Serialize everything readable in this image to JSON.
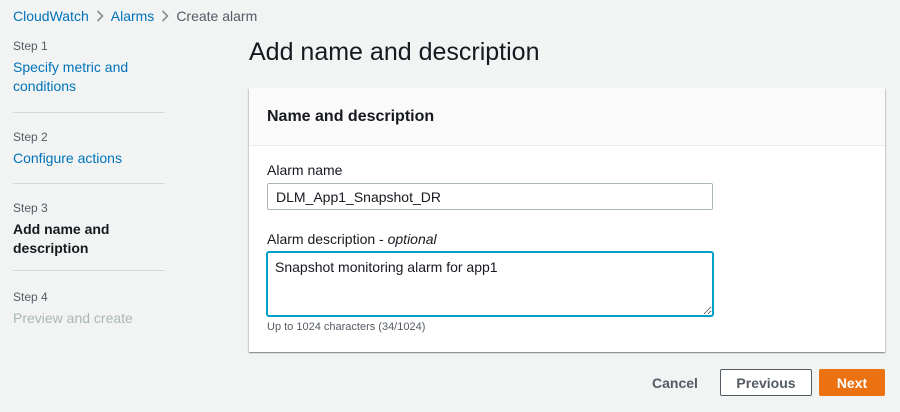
{
  "breadcrumb": {
    "items": [
      "CloudWatch",
      "Alarms",
      "Create alarm"
    ]
  },
  "steps": [
    {
      "num": "Step 1",
      "title": "Specify metric and conditions",
      "state": "link"
    },
    {
      "num": "Step 2",
      "title": "Configure actions",
      "state": "link"
    },
    {
      "num": "Step 3",
      "title": "Add name and description",
      "state": "active"
    },
    {
      "num": "Step 4",
      "title": "Preview and create",
      "state": "disabled"
    }
  ],
  "page_title": "Add name and description",
  "panel": {
    "title": "Name and description",
    "alarm_name": {
      "label": "Alarm name",
      "value": "DLM_App1_Snapshot_DR"
    },
    "alarm_description": {
      "label": "Alarm description",
      "optional": "optional",
      "value": "Snapshot monitoring alarm for app1",
      "hint": "Up to 1024 characters (34/1024)"
    }
  },
  "buttons": {
    "cancel": "Cancel",
    "previous": "Previous",
    "next": "Next"
  },
  "colors": {
    "link": "#0073bb",
    "primary": "#ec7211",
    "focus": "#00a1c9",
    "background": "#f2f3f3"
  }
}
